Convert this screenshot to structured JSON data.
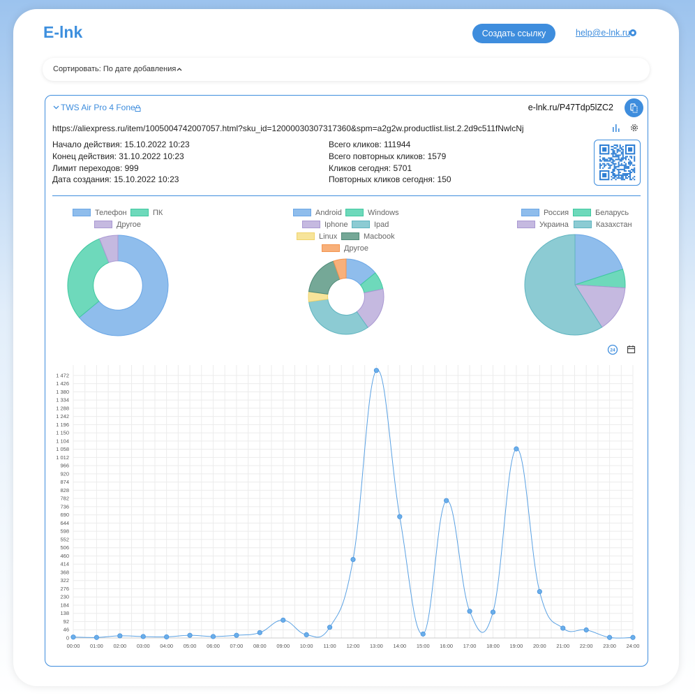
{
  "header": {
    "logo": "E-lnk",
    "create_button": "Создать ссылку",
    "help_email": "help@e-lnk.ru"
  },
  "sort": {
    "label": "Сортировать: По дате добавления",
    "icon": "chevron-up-icon"
  },
  "link": {
    "title": "TWS Air Pro 4 Fone",
    "short_url": "e-lnk.ru/P47Tdp5lZC2",
    "long_url": "https://aliexpress.ru/item/1005004742007057.html?sku_id=12000030307317360&spm=a2g2w.productlist.list.2.2d9c511fNwlcNj",
    "icons": [
      "chevron-down-icon",
      "lock-icon",
      "copy-icon",
      "bar-chart-icon",
      "gear-icon",
      "qr-code-icon"
    ]
  },
  "info_left": [
    "Начало действия: 15.10.2022 10:23",
    "Конец действия: 31.10.2022 10:23",
    "Лимит переходов: 999",
    "Дата создания: 15.10.2022 10:23"
  ],
  "info_right": [
    "Всего кликов: 111944",
    "Всего повторных кликов: 1579",
    "Кликов сегодня: 5701",
    "Повторных кликов сегодня: 150"
  ],
  "colors": {
    "accent": "#3e8ddd",
    "blue": "#8fbdec",
    "green": "#6ed9bb",
    "purple": "#c5b9e0",
    "teal": "#8ccbd3",
    "yellow": "#f7e49a",
    "darkgreen": "#75a897",
    "orange": "#f8b07a"
  },
  "device_chart": {
    "type": "pie",
    "labels": [
      "Телефон",
      "ПК",
      "Другое"
    ],
    "values": [
      64,
      30,
      6
    ]
  },
  "os_chart": {
    "type": "pie",
    "labels": [
      "Android",
      "Windows",
      "Iphone",
      "Ipad",
      "Linux",
      "Macbook",
      "Другое"
    ],
    "values": [
      13,
      7,
      17,
      30,
      4,
      16,
      5
    ]
  },
  "country_chart": {
    "type": "pie",
    "labels": [
      "Россия",
      "Беларусь",
      "Украина",
      "Казахстан"
    ],
    "values": [
      20,
      6,
      15,
      59
    ]
  },
  "toolbar": {
    "icons": [
      "clock-24-icon",
      "calendar-icon"
    ]
  },
  "chart_data": {
    "type": "line",
    "x": [
      "00:00",
      "01:00",
      "02:00",
      "03:00",
      "04:00",
      "05:00",
      "06:00",
      "07:00",
      "08:00",
      "09:00",
      "10:00",
      "11:00",
      "12:00",
      "13:00",
      "14:00",
      "15:00",
      "16:00",
      "17:00",
      "18:00",
      "19:00",
      "20:00",
      "21:00",
      "22:00",
      "23:00",
      "24:00"
    ],
    "series": [
      {
        "values": [
          5,
          3,
          12,
          8,
          6,
          15,
          8,
          15,
          30,
          100,
          18,
          60,
          440,
          1500,
          680,
          22,
          770,
          150,
          145,
          1060,
          260,
          55,
          45,
          3,
          3
        ]
      }
    ],
    "y_ticks": [
      "0",
      "46",
      "92",
      "138",
      "184",
      "230",
      "276",
      "322",
      "368",
      "414",
      "460",
      "506",
      "552",
      "598",
      "644",
      "690",
      "736",
      "782",
      "828",
      "874",
      "920",
      "966",
      "1 012",
      "1 058",
      "1 104",
      "1 150",
      "1 196",
      "1 242",
      "1 288",
      "1 334",
      "1 380",
      "1 426",
      "1 472"
    ],
    "ylim": [
      0,
      1530
    ],
    "grid": true
  }
}
